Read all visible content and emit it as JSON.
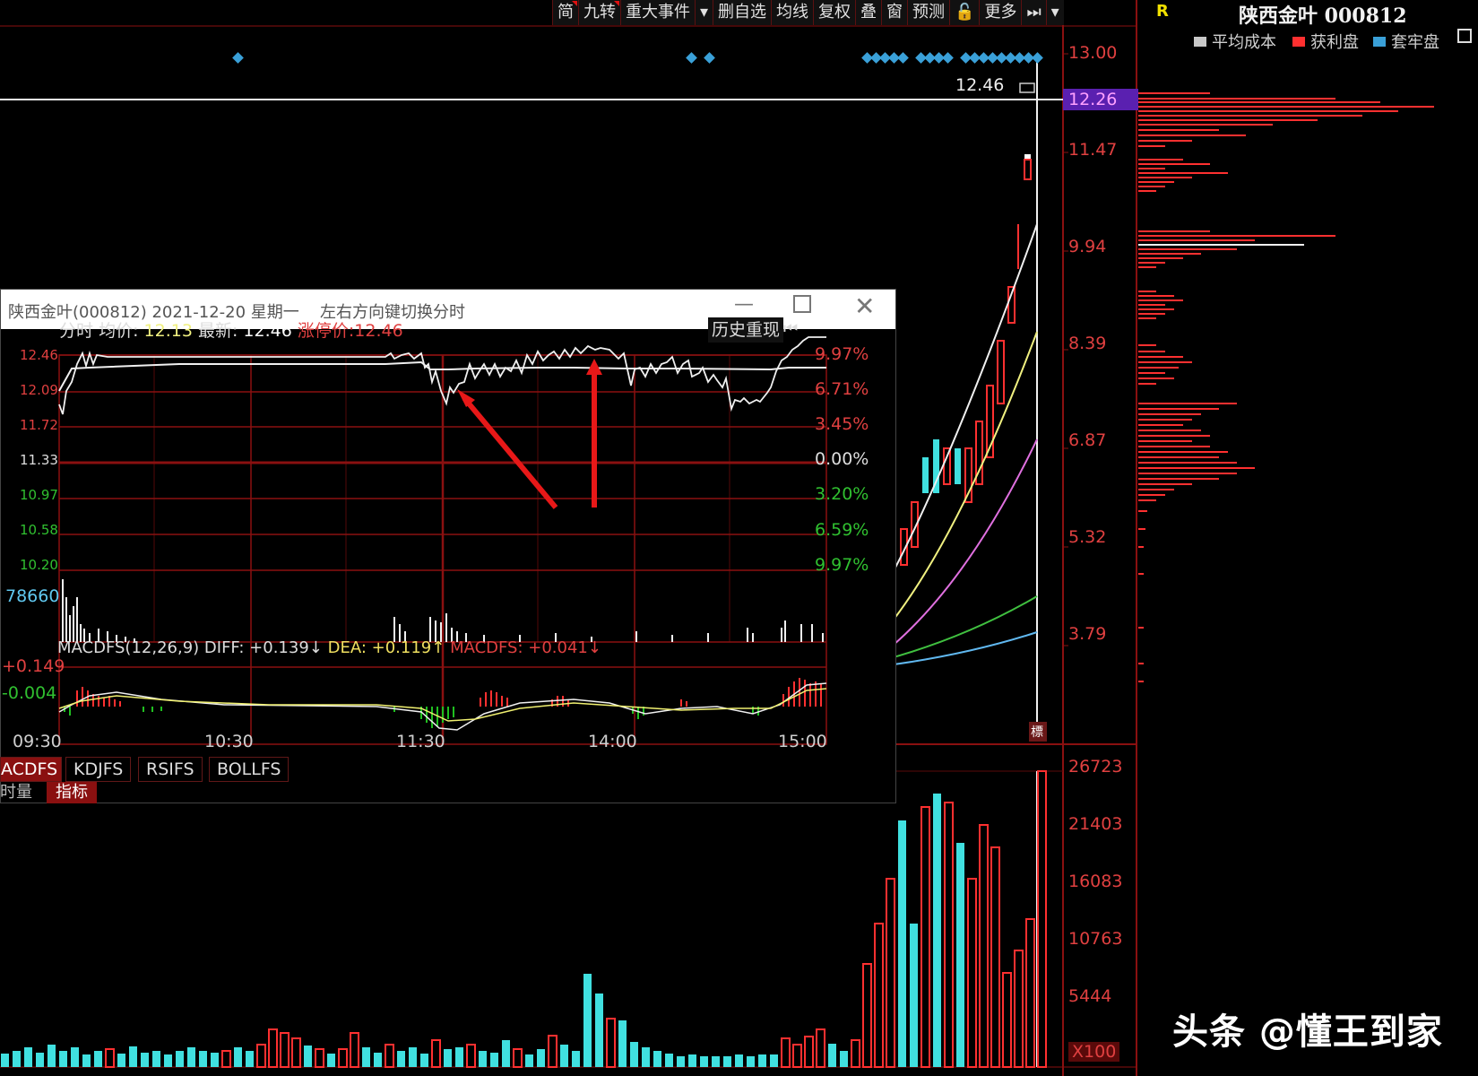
{
  "toolbar": {
    "items": [
      "简",
      "九转",
      "重大事件",
      "▾",
      "删自选",
      "均线",
      "复权",
      "叠",
      "窗",
      "预测",
      "🔓",
      "更多",
      "⏭",
      "▾"
    ]
  },
  "chart": {
    "price_axis": [
      "13.00",
      "12.26",
      "11.47",
      "9.94",
      "8.39",
      "6.87",
      "5.32",
      "3.79"
    ],
    "current_price_label": "12.46",
    "current_price_badge": "12.26",
    "volume_axis": [
      "26723",
      "21403",
      "16083",
      "10763",
      "5444",
      "X100"
    ],
    "candle_marker": "標"
  },
  "right_panel": {
    "r_label": "R",
    "stock_title": "陕西金叶 000812",
    "legend": [
      {
        "label": "平均成本",
        "color": "#c8c8c8"
      },
      {
        "label": "获利盘",
        "color": "#ff3030"
      },
      {
        "label": "套牢盘",
        "color": "#3aa0d8"
      }
    ],
    "legend_icon": "calendar-icon"
  },
  "popup": {
    "title": "陕西金叶(000812) 2021-12-20 星期一",
    "hint": "左右方向键切换分时",
    "header": {
      "prefix": "分时",
      "avg_label": "均价:",
      "avg_value": "12.13",
      "latest_label": "最新:",
      "latest_value": "12.46",
      "limit_label": "涨停价:12.46"
    },
    "history_replay": "历史重现",
    "left_axis": [
      "12.46",
      "12.09",
      "11.72",
      "11.33",
      "10.97",
      "10.58",
      "10.20"
    ],
    "right_axis": [
      "9.97%",
      "6.71%",
      "3.45%",
      "0.00%",
      "3.20%",
      "6.59%",
      "9.97%"
    ],
    "volume_label": "78660",
    "macd_header": {
      "name": "MACDFS(12,26,9)",
      "diff": "DIFF: +0.139↓",
      "dea": "DEA: +0.119↑",
      "macdfs": "MACDFS: +0.041↓"
    },
    "macd_axis": [
      "+0.149",
      "-0.004"
    ],
    "time_axis": [
      "09:30",
      "10:30",
      "11:30",
      "14:00",
      "15:00"
    ],
    "tabs": [
      "ACDFS",
      "KDJFS",
      "RSIFS",
      "BOLLFS"
    ],
    "subtabs": [
      "时量",
      "指标"
    ]
  },
  "watermark": "头条 @懂王到家"
}
